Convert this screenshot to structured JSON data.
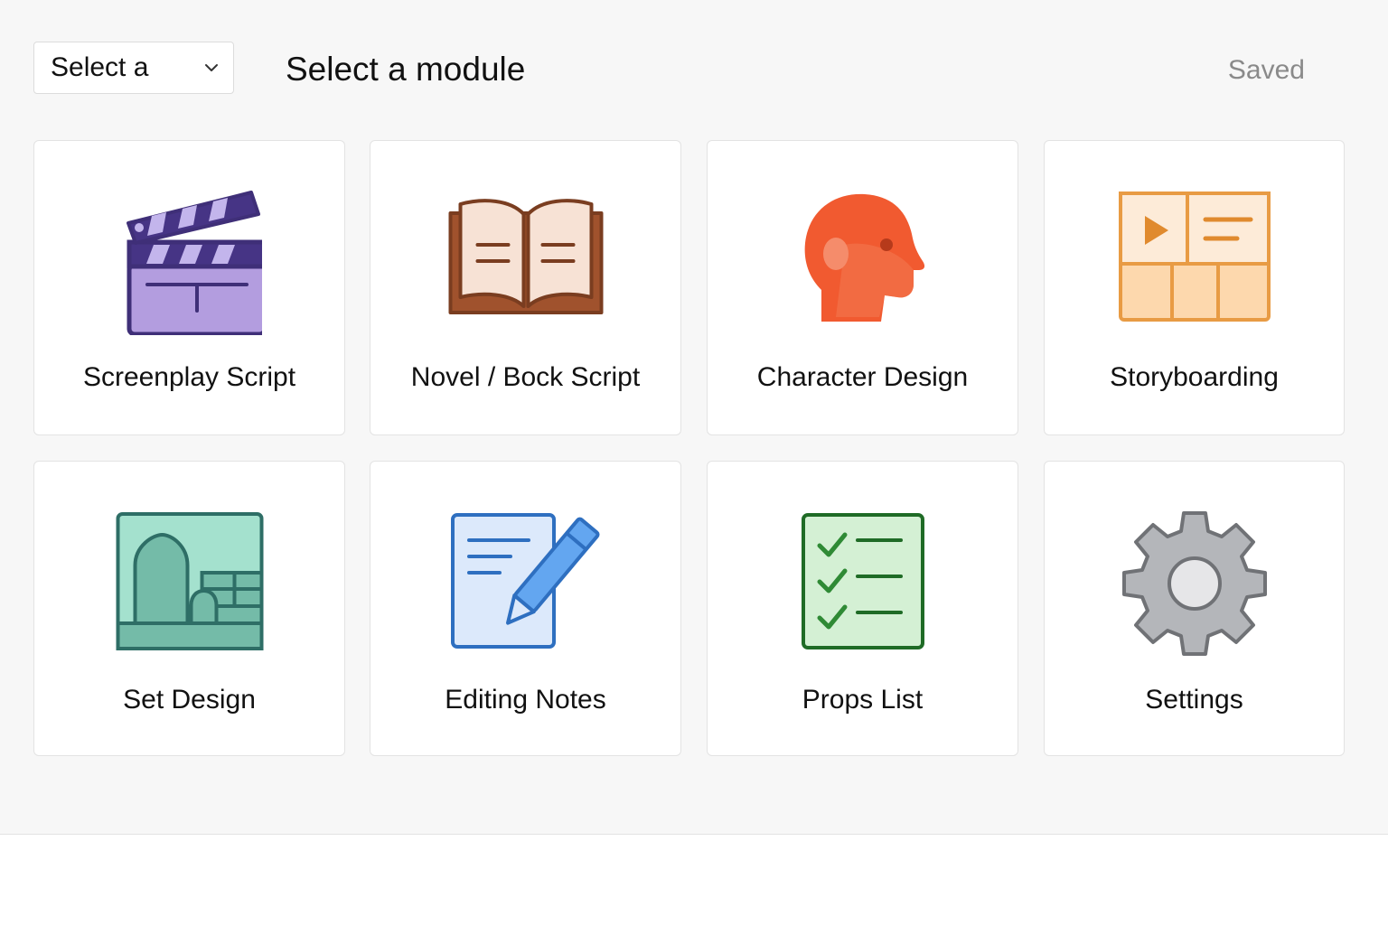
{
  "header": {
    "select_label": "Select a",
    "title": "Select a module",
    "status": "Saved"
  },
  "modules": [
    {
      "label": "Screenplay Script",
      "icon": "clapperboard-icon",
      "color": "#b19de0"
    },
    {
      "label": "Novel / Bock Script",
      "icon": "open-book-icon",
      "color": "#a0522d"
    },
    {
      "label": "Character Design",
      "icon": "head-profile-icon",
      "color": "#f15a30"
    },
    {
      "label": "Storyboarding",
      "icon": "storyboard-icon",
      "color": "#f0a347"
    },
    {
      "label": "Set Design",
      "icon": "stage-set-icon",
      "color": "#7fc7b0"
    },
    {
      "label": "Editing Notes",
      "icon": "document-pencil-icon",
      "color": "#3c7fd0"
    },
    {
      "label": "Props List",
      "icon": "checklist-icon",
      "color": "#2f8a35"
    },
    {
      "label": "Settings",
      "icon": "gear-icon",
      "color": "#b4b6ba"
    }
  ]
}
